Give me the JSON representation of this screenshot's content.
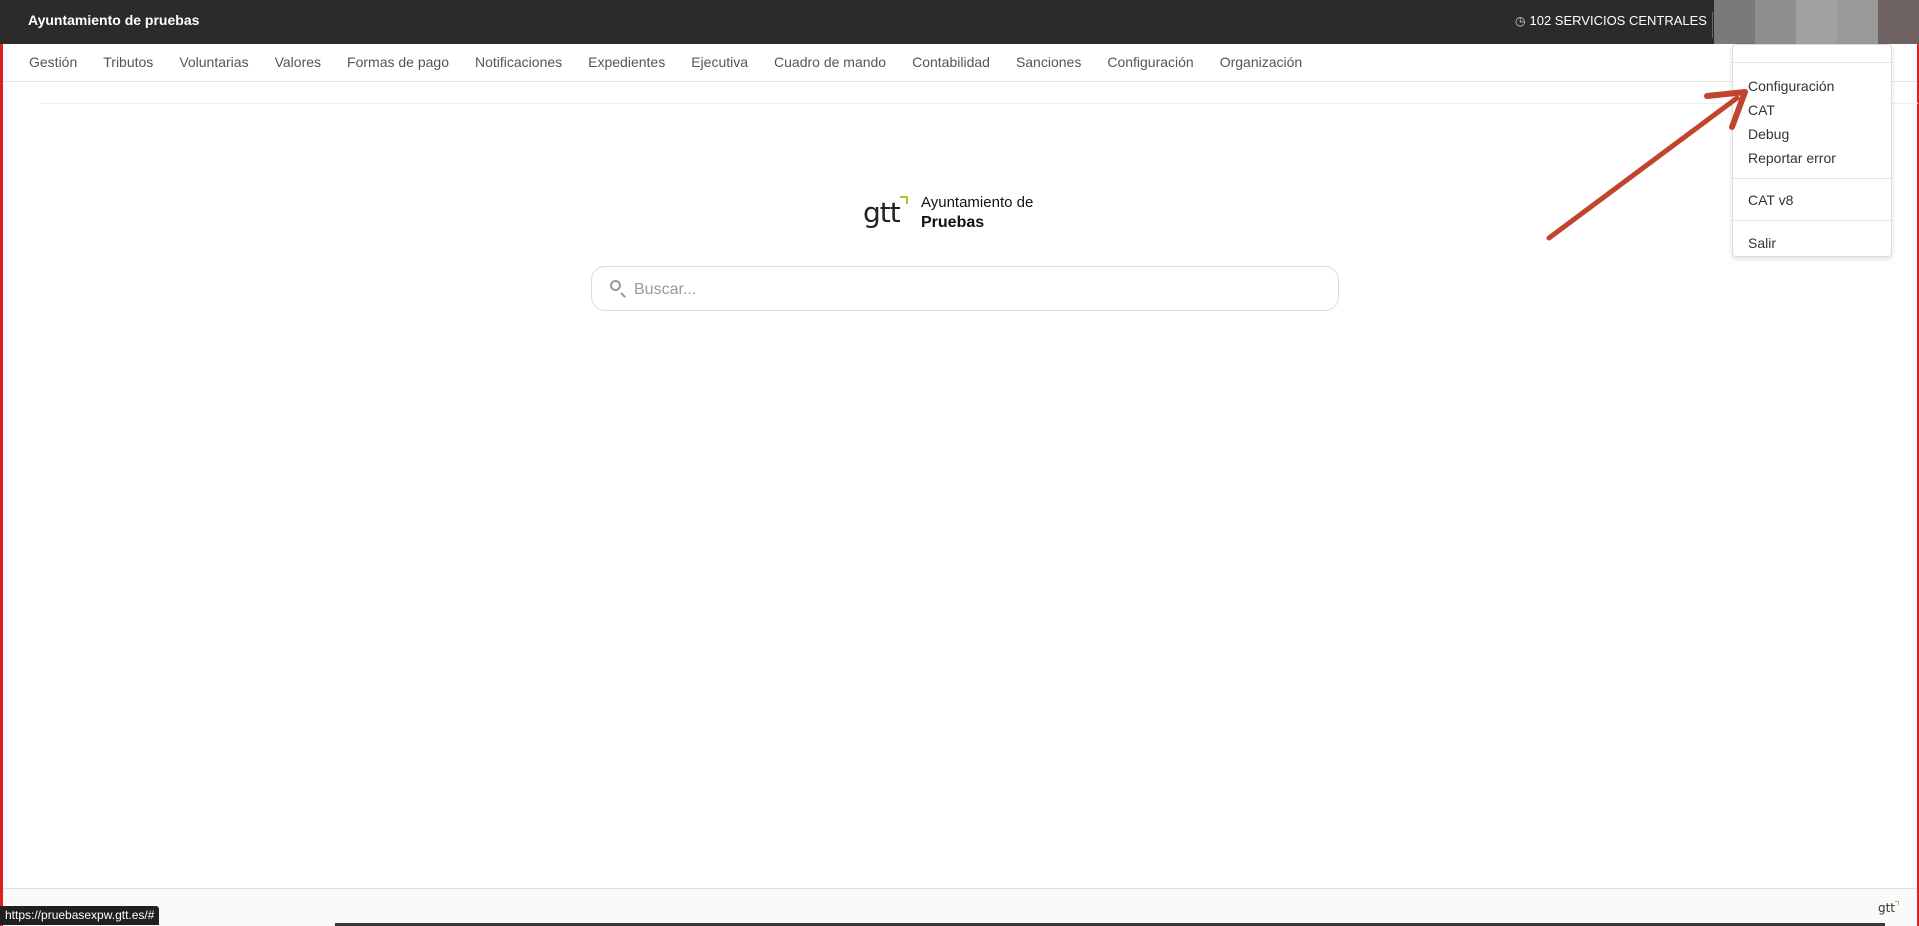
{
  "topbar": {
    "title": "Ayuntamiento de pruebas",
    "office_label": "102 SERVICIOS CENTRALES",
    "clock_icon": "clock-icon"
  },
  "menu": [
    {
      "label": "Gestión"
    },
    {
      "label": "Tributos"
    },
    {
      "label": "Voluntarias"
    },
    {
      "label": "Valores"
    },
    {
      "label": "Formas de pago"
    },
    {
      "label": "Notificaciones"
    },
    {
      "label": "Expedientes"
    },
    {
      "label": "Ejecutiva"
    },
    {
      "label": "Cuadro de mando"
    },
    {
      "label": "Contabilidad"
    },
    {
      "label": "Sanciones"
    },
    {
      "label": "Configuración"
    },
    {
      "label": "Organización"
    }
  ],
  "brand": {
    "logo_text": "gtt",
    "line1": "Ayuntamiento de",
    "line2": "Pruebas"
  },
  "search": {
    "placeholder": "Buscar...",
    "value": ""
  },
  "user_menu": {
    "items_group1": [
      "Configuración",
      "CAT",
      "Debug",
      "Reportar error"
    ],
    "items_group2": [
      "CAT v8"
    ],
    "items_group3": [
      "Salir"
    ]
  },
  "footer": {
    "logo_text": "gtt",
    "status_url": "https://pruebasexpw.gtt.es/#"
  },
  "colors": {
    "topbar_bg": "#2b2b2b",
    "accent_green": "#9ccc2e",
    "annotation_arrow": "#c0442e",
    "frame_red": "#e02020"
  }
}
